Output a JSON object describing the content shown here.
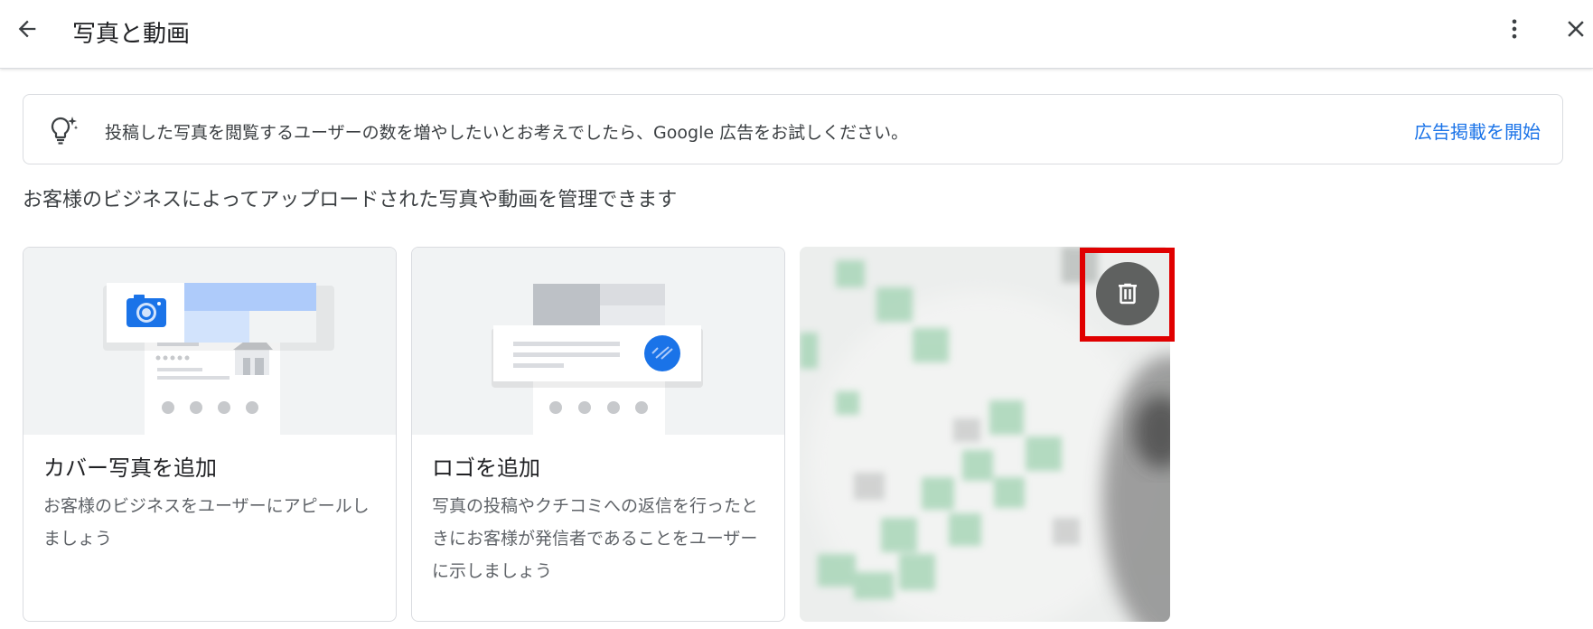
{
  "header": {
    "title": "写真と動画",
    "back_icon": "arrow-back-icon",
    "more_icon": "more-vert-icon",
    "close_icon": "close-icon"
  },
  "banner": {
    "icon": "lightbulb-sparkle-icon",
    "message": "投稿した写真を閲覧するユーザーの数を増やしたいとお考えでしたら、Google 広告をお試しください。",
    "cta": "広告掲載を開始"
  },
  "subtitle": "お客様のビジネスによってアップロードされた写真や動画を管理できます",
  "cards": [
    {
      "title": "カバー写真を追加",
      "description": "お客様のビジネスをユーザーにアピールしましょう"
    },
    {
      "title": "ロゴを追加",
      "description": "写真の投稿やクチコミへの返信を行ったときにお客様が発信者であることをユーザーに示しましょう"
    }
  ],
  "photo": {
    "delete_icon": "trash-icon"
  },
  "colors": {
    "accent": "#1a73e8",
    "highlight": "#e00000",
    "delete_bg": "#5f6160"
  }
}
